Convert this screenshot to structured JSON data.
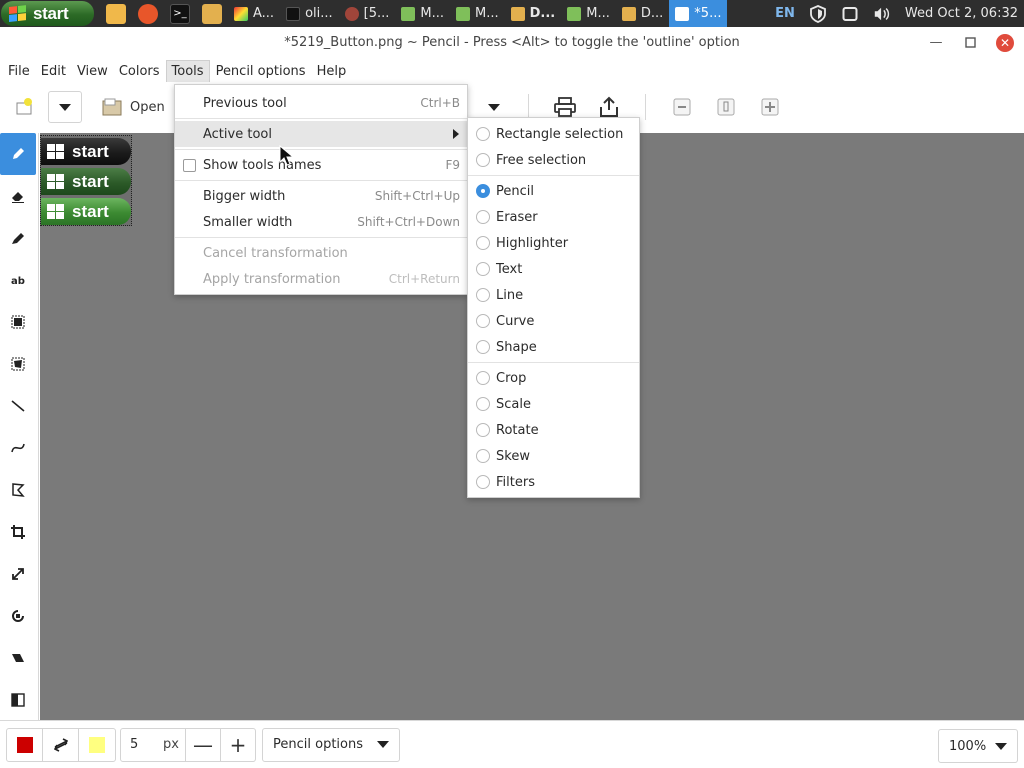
{
  "taskbar": {
    "start_label": "start",
    "tasks": [
      {
        "label": "A...",
        "icon": "color-app-icon"
      },
      {
        "label": "oli...",
        "icon": "terminal-icon"
      },
      {
        "label": "[5...",
        "icon": "ubuntu-icon"
      },
      {
        "label": "M...",
        "icon": "editor-icon"
      },
      {
        "label": "M...",
        "icon": "editor-icon"
      },
      {
        "label": "D...",
        "icon": "folder-icon"
      },
      {
        "label": "M...",
        "icon": "editor-icon"
      },
      {
        "label": "D...",
        "icon": "folder-icon"
      },
      {
        "label": "*5...",
        "icon": "pencil-app-icon"
      }
    ],
    "lang": "EN",
    "clock": "Wed Oct  2, 06:32"
  },
  "window": {
    "title": "*5219_Button.png ~ Pencil - Press <Alt> to toggle the 'outline' option"
  },
  "menubar": [
    "File",
    "Edit",
    "View",
    "Colors",
    "Tools",
    "Pencil options",
    "Help"
  ],
  "toolbar": {
    "open_label": "Open"
  },
  "tools_menu": {
    "items": [
      {
        "label": "Previous tool",
        "accel": "Ctrl+B"
      },
      {
        "label": "Active tool",
        "accel": ""
      },
      {
        "label": "Show tools names",
        "accel": "F9"
      },
      {
        "label": "Bigger width",
        "accel": "Shift+Ctrl+Up"
      },
      {
        "label": "Smaller width",
        "accel": "Shift+Ctrl+Down"
      },
      {
        "label": "Cancel transformation",
        "accel": ""
      },
      {
        "label": "Apply transformation",
        "accel": "Ctrl+Return"
      }
    ]
  },
  "active_tool_menu": {
    "items": [
      "Rectangle selection",
      "Free selection",
      "Pencil",
      "Eraser",
      "Highlighter",
      "Text",
      "Line",
      "Curve",
      "Shape",
      "Crop",
      "Scale",
      "Rotate",
      "Skew",
      "Filters"
    ],
    "selected": "Pencil"
  },
  "canvas": {
    "buttons": [
      "start",
      "start",
      "start"
    ]
  },
  "bottombar": {
    "main_color": "#cc0000",
    "secondary_color": "#ffff80",
    "size_value": "5",
    "size_unit": "px",
    "options_label": "Pencil options",
    "zoom": "100%"
  },
  "colors": {
    "accent": "#3b8ede",
    "canvas_bg": "#7a7a7a"
  }
}
